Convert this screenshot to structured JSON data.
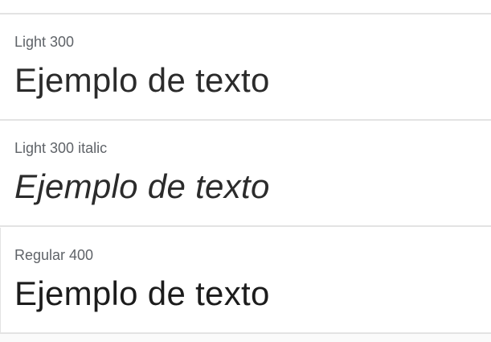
{
  "font_styles": [
    {
      "label": "Light 300",
      "sample": "Ejemplo de texto"
    },
    {
      "label": "Light 300 italic",
      "sample": "Ejemplo de texto"
    },
    {
      "label": "Regular 400",
      "sample": "Ejemplo de texto"
    }
  ]
}
